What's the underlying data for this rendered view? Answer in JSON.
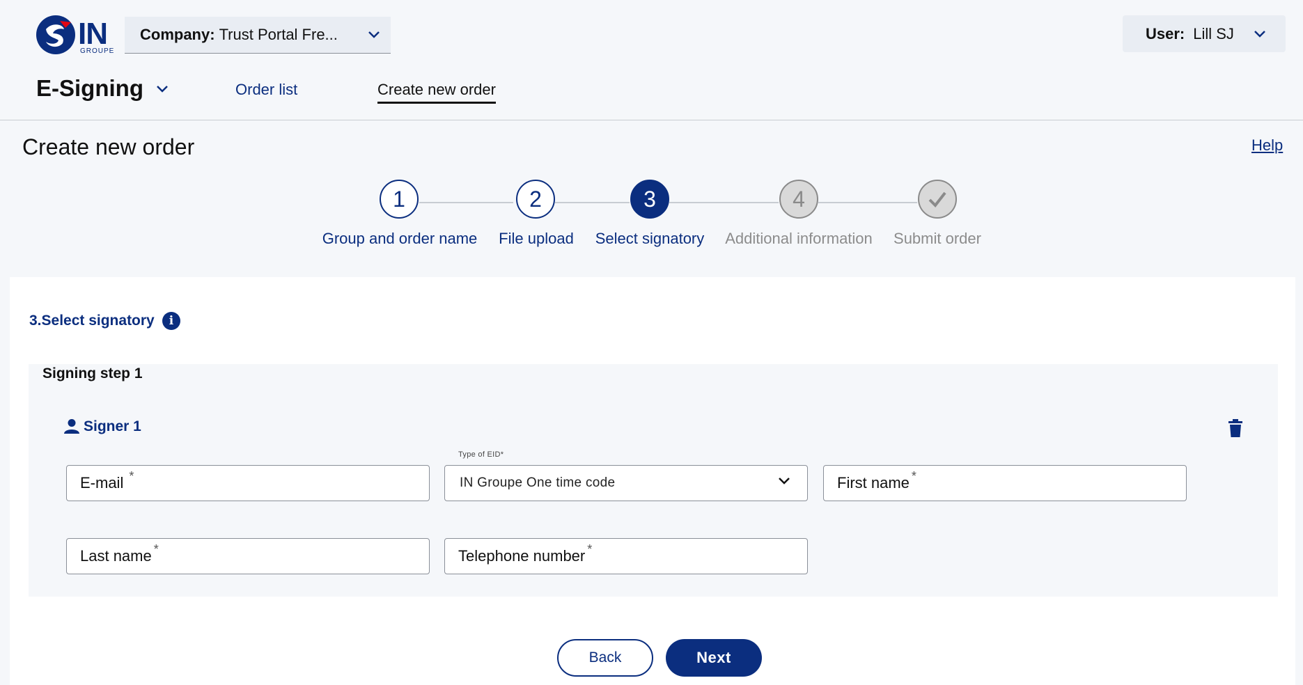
{
  "brand": {
    "logo_text": "IN",
    "logo_sub": "GROUPE"
  },
  "header": {
    "company_label": "Company:",
    "company_value": "Trust Portal Fre...",
    "user_label": "User:",
    "user_value": "Lill SJ",
    "app_title": "E-Signing",
    "nav": {
      "order_list": "Order list",
      "create_new_order": "Create new order"
    }
  },
  "page": {
    "title": "Create new order",
    "help": "Help"
  },
  "stepper": {
    "steps": [
      {
        "number": "1",
        "label": "Group and order name",
        "state": "done"
      },
      {
        "number": "2",
        "label": "File upload",
        "state": "done"
      },
      {
        "number": "3",
        "label": "Select signatory",
        "state": "active"
      },
      {
        "number": "4",
        "label": "Additional information",
        "state": "todo"
      },
      {
        "number": "✓",
        "label": "Submit order",
        "state": "todo"
      }
    ]
  },
  "section": {
    "title": "3.Select signatory",
    "info_icon": "i",
    "signing_step": "Signing step 1",
    "signer_label": "Signer 1"
  },
  "form": {
    "email_placeholder": "E-mail",
    "eid_label": "Type of EID*",
    "eid_value": "IN Groupe One time code",
    "first_name_placeholder": "First name",
    "last_name_placeholder": "Last name",
    "telephone_placeholder": "Telephone number",
    "required_mark": "*"
  },
  "buttons": {
    "back": "Back",
    "next": "Next"
  },
  "colors": {
    "primary": "#0b2e7f",
    "background": "#f5f7fa",
    "inactive": "#8c8c8c"
  },
  "icons": [
    "chevron-down-icon",
    "info-icon",
    "user-icon",
    "trash-icon",
    "checkmark-icon"
  ]
}
